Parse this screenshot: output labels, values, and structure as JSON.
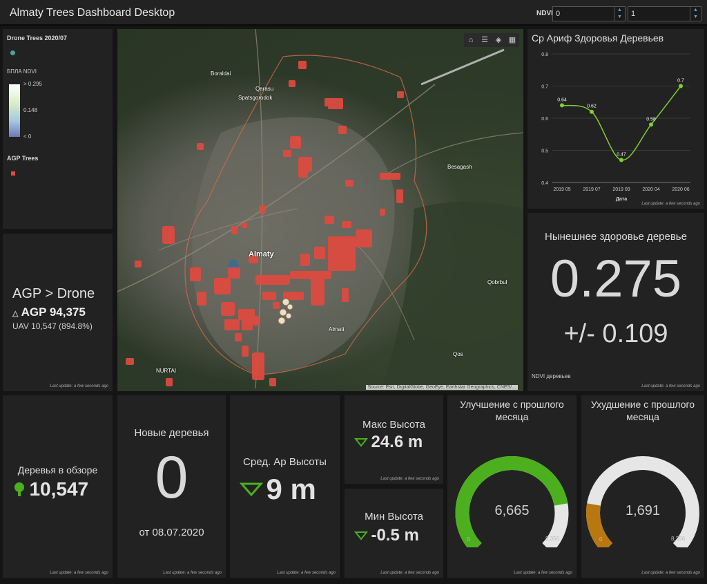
{
  "header": {
    "title": "Almaty Trees Dashboard Desktop",
    "ndvi_label": "NDVI",
    "ndvi_min": "0",
    "ndvi_max": "1"
  },
  "legend": {
    "layer1": "Drone Trees 2020/07",
    "layer2": "БПЛА NDVI",
    "ramp_max": "> 0.295",
    "ramp_mid": "0.148",
    "ramp_min": "< 0",
    "layer3": "AGP Trees"
  },
  "compare": {
    "title": "AGP > Drone",
    "agp": "AGP 94,375",
    "uav": "UAV 10,547 (894.8%)",
    "footer": "Last update: a few seconds ago"
  },
  "map": {
    "city_label": "Almaty",
    "places": [
      "Boraldai",
      "Qarasu",
      "Spatsgorodok",
      "Besagash",
      "Almati",
      "Qobrbul",
      "NURTAI",
      "Qos"
    ],
    "attribution": "Source: Esri, DigitalGlobe, GeoEye, Earthstar Geographics, CNES/..."
  },
  "chart_panel": {
    "title": "Ср Ариф  Здоровья Деревьев",
    "footer": "Last update: a few seconds ago"
  },
  "chart_data": {
    "type": "line",
    "title": "Ср Ариф  Здоровья Деревьев",
    "xlabel": "Дата",
    "ylabel": "",
    "categories": [
      "2019 05",
      "2019 07",
      "2019 09",
      "2020 04",
      "2020 06"
    ],
    "values": [
      0.64,
      0.62,
      0.47,
      0.58,
      0.7
    ],
    "data_labels": [
      "0.64",
      "0.62",
      "0.47",
      "0.58",
      "0.7"
    ],
    "yticks": [
      "0.4",
      "0.5",
      "0.6",
      "0.7",
      "0.8"
    ],
    "ylim": [
      0.4,
      0.8
    ],
    "grid": true,
    "color": "#7fd12b"
  },
  "health": {
    "title": "Нынешнее здоровье деревье",
    "value": "0.275",
    "range": "+/- 0.109",
    "caption": "NDVI деревьев",
    "footer": "Last update: a few seconds ago"
  },
  "trees_review": {
    "label": "Деревья в обзоре",
    "value": "10,547",
    "footer": "Last update: a few seconds ago"
  },
  "new_trees": {
    "title": "Новые деревья",
    "value": "0",
    "date": "от 08.07.2020",
    "footer": "Last update: a few seconds ago"
  },
  "avg_height": {
    "title": "Сред. Ар Высоты",
    "value": "9 m",
    "footer": "Last update: a few seconds ago"
  },
  "max_height": {
    "title": "Макс Высота",
    "value": "24.6 m",
    "footer": "Last update: a few seconds ago"
  },
  "min_height": {
    "title": "Мин Высота",
    "value": "-0.5 m",
    "footer": "Last update: a few seconds ago"
  },
  "improve": {
    "title": "Улучшение с прошлого месяца",
    "value": "6,665",
    "min": "0",
    "max": "8,356",
    "fraction": 0.7976,
    "color": "#4caf1d",
    "footer": "Last update: a few seconds ago"
  },
  "decline": {
    "title": "Ухудшение с прошлого месяца",
    "value": "1,691",
    "min": "0",
    "max": "8,356",
    "fraction": 0.2024,
    "color": "#b8780f",
    "footer": "Last update: a few seconds ago"
  },
  "colors": {
    "accent_green": "#7fd12b",
    "tree_red": "#e04a3f",
    "background": "#222222"
  }
}
